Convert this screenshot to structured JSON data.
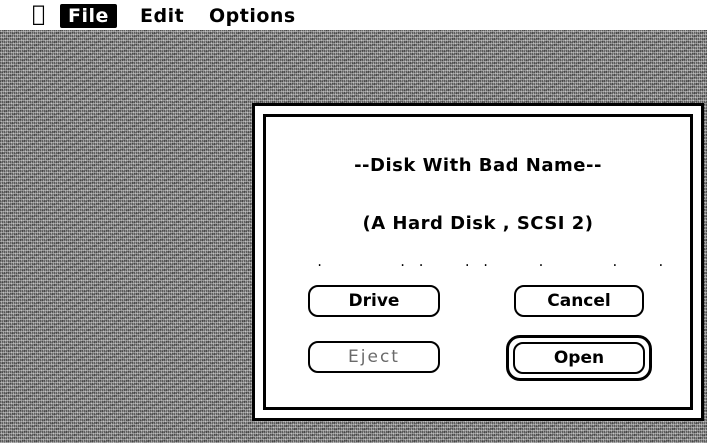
{
  "menubar": {
    "apple_icon": "apple-icon",
    "items": [
      "File",
      "Edit",
      "Options"
    ],
    "active_item": "File"
  },
  "dialog": {
    "disk_name": "--Disk With Bad Name--",
    "disk_info": "(A Hard Disk , SCSI 2)",
    "file_list_dots": ".        . .    . .     .       .    .",
    "buttons": {
      "drive": "Drive",
      "cancel": "Cancel",
      "eject": "Eject",
      "open": "Open"
    },
    "eject_disabled": true,
    "default_button": "Open"
  },
  "colors": {
    "menubar_bg": "#ffffff",
    "selected_menu_bg": "#000000",
    "dialog_bg": "#ffffff",
    "disabled_text": "#6a6a6a"
  }
}
